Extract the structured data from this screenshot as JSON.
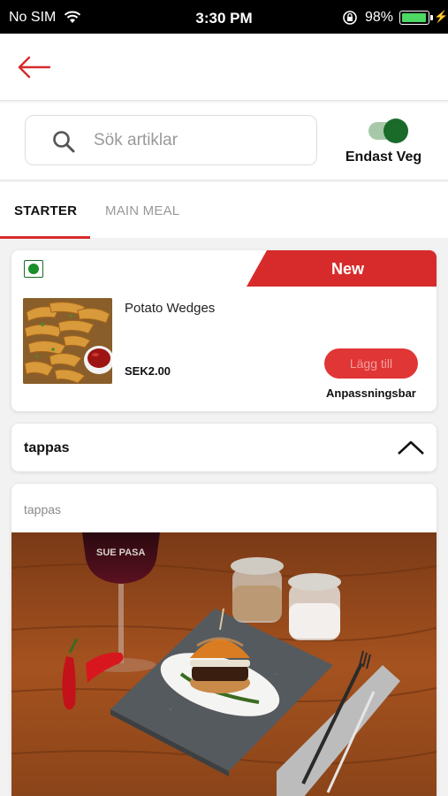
{
  "status_bar": {
    "carrier": "No SIM",
    "time": "3:30 PM",
    "battery_percent": "98%",
    "battery_level": 0.98,
    "battery_color": "#4cd964"
  },
  "header": {
    "back_icon": "arrow-left-icon",
    "accent_color": "#d72b2b"
  },
  "search": {
    "placeholder": "Sök artiklar",
    "value": "",
    "icon": "search-icon"
  },
  "veg_filter": {
    "label": "Endast Veg",
    "enabled": true,
    "color": "#1a6b2a"
  },
  "tabs": [
    {
      "label": "STARTER",
      "active": true
    },
    {
      "label": "MAIN MEAL",
      "active": false
    }
  ],
  "featured_item": {
    "badge": "New",
    "name": "Potato Wedges",
    "price": "SEK2.00",
    "add_label": "Lägg till",
    "customizable_label": "Anpassningsbar",
    "is_veg": true
  },
  "category": {
    "title": "tappas",
    "subtitle": "tappas",
    "expanded": true,
    "chevron_icon": "chevron-up-icon"
  }
}
